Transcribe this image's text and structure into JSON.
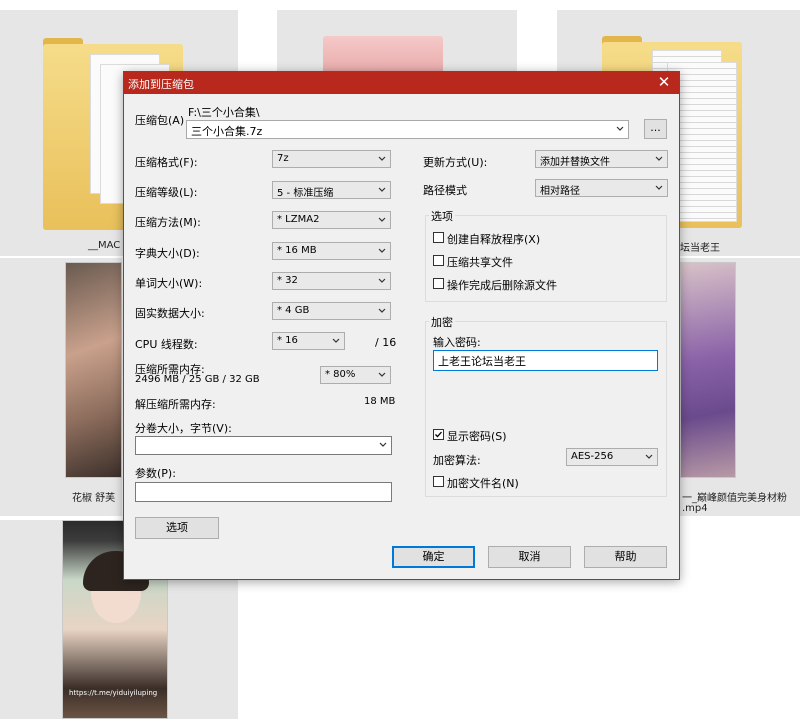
{
  "explorer": {
    "files": [
      {
        "name": "__MAC"
      },
      {
        "name": "坛当老王"
      },
      {
        "name": "花椒 舒芙"
      },
      {
        "name": "一_巅峰颜值完美身材粉"
      },
      {
        "name": ".mp4"
      }
    ],
    "thumb_watermark": "https://t.me/yiduiyiluping"
  },
  "dialog": {
    "title": "添加到压缩包",
    "close_glyph": "✕",
    "archive": {
      "label": "压缩包(A)",
      "path": "F:\\三个小合集\\",
      "name": "三个小合集.7z",
      "browse_label": "..."
    },
    "format": {
      "label": "压缩格式(F):",
      "value": "7z"
    },
    "level": {
      "label": "压缩等级(L):",
      "value": "5 - 标准压缩"
    },
    "method": {
      "label": "压缩方法(M):",
      "value": "* LZMA2"
    },
    "dict": {
      "label": "字典大小(D):",
      "value": "* 16 MB"
    },
    "word": {
      "label": "单词大小(W):",
      "value": "* 32"
    },
    "solid": {
      "label": "固实数据大小:",
      "value": "* 4 GB"
    },
    "cpu": {
      "label": "CPU 线程数:",
      "value": "* 16",
      "max": "/ 16"
    },
    "mem_compress": {
      "label": "压缩所需内存:",
      "detail": "2496 MB / 25 GB / 32 GB",
      "percent": "* 80%"
    },
    "mem_decompress": {
      "label": "解压缩所需内存:",
      "value": "18 MB"
    },
    "split": {
      "label": "分卷大小，字节(V):",
      "value": ""
    },
    "params": {
      "label": "参数(P):",
      "value": ""
    },
    "options_button": "选项",
    "update": {
      "label": "更新方式(U):",
      "value": "添加并替换文件"
    },
    "path_mode": {
      "label": "路径模式",
      "value": "相对路径"
    },
    "options_group": {
      "title": "选项",
      "sfx": {
        "label": "创建自释放程序(X)",
        "checked": false
      },
      "shared": {
        "label": "压缩共享文件",
        "checked": false
      },
      "delete": {
        "label": "操作完成后删除源文件",
        "checked": false
      }
    },
    "encryption": {
      "title": "加密",
      "password_label": "输入密码:",
      "password_value": "上老王论坛当老王",
      "show_password": {
        "label": "显示密码(S)",
        "checked": true
      },
      "method_label": "加密算法:",
      "method_value": "AES-256",
      "encrypt_names": {
        "label": "加密文件名(N)",
        "checked": false
      }
    },
    "buttons": {
      "ok": "确定",
      "cancel": "取消",
      "help": "帮助"
    }
  }
}
